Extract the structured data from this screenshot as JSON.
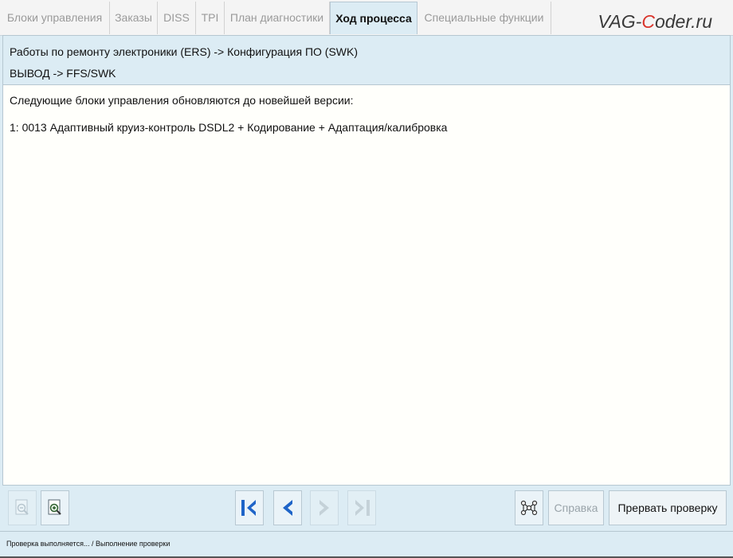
{
  "tabs": [
    {
      "label": "Блоки управления"
    },
    {
      "label": "Заказы"
    },
    {
      "label": "DISS"
    },
    {
      "label": "TPI"
    },
    {
      "label": "План диагностики"
    },
    {
      "label": "Ход процесса"
    },
    {
      "label": "Специальные функции"
    }
  ],
  "brand": {
    "prefix": "VAG-",
    "accent": "C",
    "suffix": "oder.ru"
  },
  "header": {
    "path": "Работы по ремонту электроники (ERS) -> Конфигурация ПО (SWK)",
    "output": "ВЫВОД -> FFS/SWK"
  },
  "content": {
    "intro": "Следующие блоки управления обновляются до новейшей версии:",
    "items": [
      "1: 0013 Адаптивный круиз-контроль DSDL2 + Кодирование + Адаптация/калибровка"
    ]
  },
  "toolbar": {
    "help_label": "Справка",
    "abort_label": "Прервать проверку"
  },
  "status": {
    "text": "Проверка выполняется... / Выполнение проверки"
  },
  "colors": {
    "accent_blue": "#1e64c8",
    "panel_bg": "#dcecf4",
    "brand_red": "#d9342b"
  }
}
